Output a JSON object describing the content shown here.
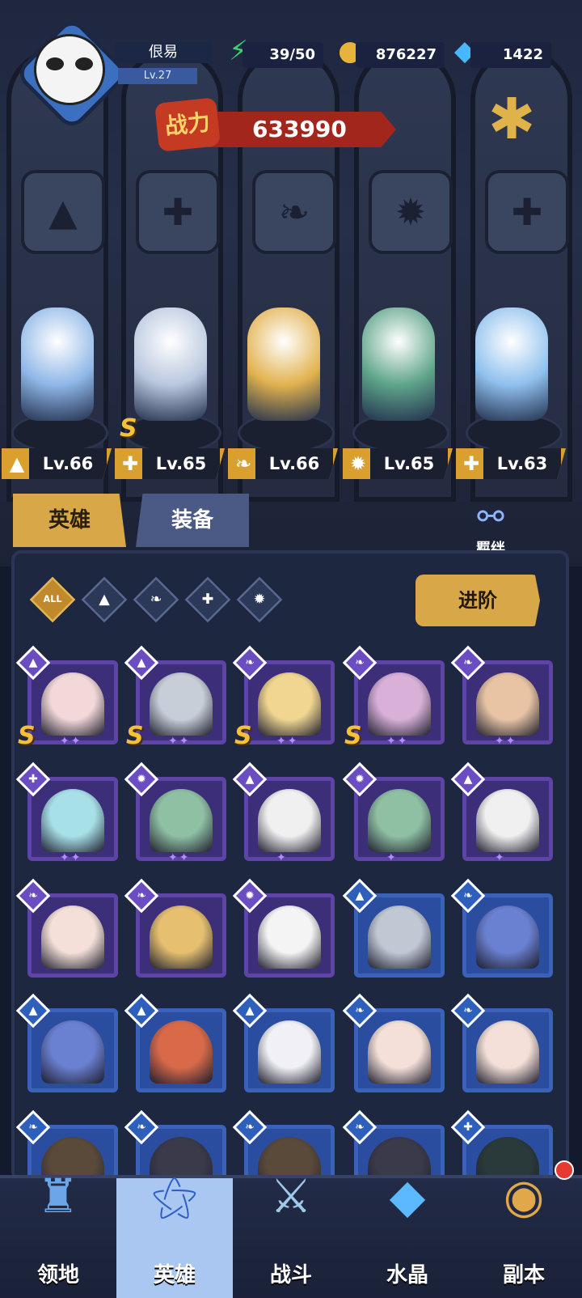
{
  "player": {
    "name": "佷易",
    "level": "Lv.27"
  },
  "resources": [
    {
      "id": "energy",
      "value": "39/50",
      "icon": "lightning-bolt-icon",
      "color": "#3fd06e"
    },
    {
      "id": "gold",
      "value": "876227",
      "icon": "gold-coin-icon",
      "color": "#e7b33a"
    },
    {
      "id": "diamond",
      "value": "1422",
      "icon": "diamond-icon",
      "color": "#46b8ff"
    }
  ],
  "power": {
    "label": "战力",
    "value": "633990"
  },
  "formation": [
    {
      "level": "Lv.66",
      "class": "hat-class-icon",
      "figure_color": "#8fb7e8",
      "s_rank": false
    },
    {
      "level": "Lv.65",
      "class": "wrench-class-icon",
      "figure_color": "#b9c7de",
      "s_rank": true
    },
    {
      "level": "Lv.66",
      "class": "wing-class-icon",
      "figure_color": "#e2b24f",
      "s_rank": false
    },
    {
      "level": "Lv.65",
      "class": "fang-class-icon",
      "figure_color": "#5fa58a",
      "s_rank": false
    },
    {
      "level": "Lv.63",
      "class": "wrench-class-icon",
      "figure_color": "#8fc0ee",
      "s_rank": false
    }
  ],
  "tabs": {
    "heroes": "英雄",
    "equipment": "装备"
  },
  "bond_label": "羁绊",
  "filters": {
    "all": "ALL"
  },
  "advance_label": "进阶",
  "cards": [
    {
      "frame": "purple",
      "class": "hat",
      "s_rank": true,
      "stars": "✦✦",
      "face": "#f2d8d8"
    },
    {
      "frame": "purple",
      "class": "hat",
      "s_rank": true,
      "stars": "✦✦",
      "face": "#c7ced8"
    },
    {
      "frame": "purple",
      "class": "wing",
      "s_rank": true,
      "stars": "✦✦",
      "face": "#f0d690"
    },
    {
      "frame": "purple",
      "class": "wing",
      "s_rank": true,
      "stars": "✦✦",
      "face": "#d8b0d8"
    },
    {
      "frame": "purple",
      "class": "wing",
      "s_rank": false,
      "stars": "✦✦",
      "face": "#e8c4a4"
    },
    {
      "frame": "purple",
      "class": "wrench",
      "s_rank": false,
      "stars": "✦✦",
      "face": "#a8e0e8"
    },
    {
      "frame": "purple",
      "class": "fang",
      "s_rank": false,
      "stars": "✦✦",
      "face": "#8fc0a4"
    },
    {
      "frame": "purple",
      "class": "hat",
      "s_rank": false,
      "stars": "✦",
      "face": "#f0f0f0"
    },
    {
      "frame": "purple",
      "class": "fang",
      "s_rank": false,
      "stars": "✦",
      "face": "#8fc0a4"
    },
    {
      "frame": "purple",
      "class": "hat",
      "s_rank": false,
      "stars": "✦",
      "face": "#f0f0f0"
    },
    {
      "frame": "purple",
      "class": "wing",
      "s_rank": false,
      "stars": "",
      "face": "#f4e0d8"
    },
    {
      "frame": "purple",
      "class": "wing",
      "s_rank": false,
      "stars": "",
      "face": "#e6c070"
    },
    {
      "frame": "purple",
      "class": "fang",
      "s_rank": false,
      "stars": "",
      "face": "#f4f4f4"
    },
    {
      "frame": "blue",
      "class": "hat",
      "s_rank": false,
      "stars": "",
      "face": "#c0c8d4"
    },
    {
      "frame": "blue",
      "class": "wing",
      "s_rank": false,
      "stars": "",
      "face": "#6a80d0"
    },
    {
      "frame": "blue",
      "class": "hat",
      "s_rank": false,
      "stars": "",
      "face": "#6a80d0"
    },
    {
      "frame": "blue",
      "class": "hat",
      "s_rank": false,
      "stars": "",
      "face": "#d86a4a"
    },
    {
      "frame": "blue",
      "class": "hat",
      "s_rank": false,
      "stars": "",
      "face": "#f0f0f6"
    },
    {
      "frame": "blue",
      "class": "wing",
      "s_rank": false,
      "stars": "",
      "face": "#f4e0d8"
    },
    {
      "frame": "blue",
      "class": "wing",
      "s_rank": false,
      "stars": "",
      "face": "#f4e0d8"
    },
    {
      "frame": "blue",
      "class": "wing",
      "s_rank": false,
      "stars": "",
      "face": "#5a4a3a"
    },
    {
      "frame": "blue",
      "class": "wing",
      "s_rank": false,
      "stars": "",
      "face": "#3a3a4a"
    },
    {
      "frame": "blue",
      "class": "wing",
      "s_rank": false,
      "stars": "",
      "face": "#5a4a3a"
    },
    {
      "frame": "blue",
      "class": "wing",
      "s_rank": false,
      "stars": "",
      "face": "#3a3a4a"
    },
    {
      "frame": "blue",
      "class": "wrench",
      "s_rank": false,
      "stars": "",
      "face": "#2a3a3a"
    }
  ],
  "nav": [
    {
      "label": "领地",
      "icon": "castle-icon",
      "active": false,
      "dot": false
    },
    {
      "label": "英雄",
      "icon": "wizard-hat-icon",
      "active": true,
      "dot": false
    },
    {
      "label": "战斗",
      "icon": "sword-icon",
      "active": false,
      "dot": false
    },
    {
      "label": "水晶",
      "icon": "crystal-icon",
      "active": false,
      "dot": false
    },
    {
      "label": "副本",
      "icon": "portal-icon",
      "active": false,
      "dot": true
    }
  ]
}
